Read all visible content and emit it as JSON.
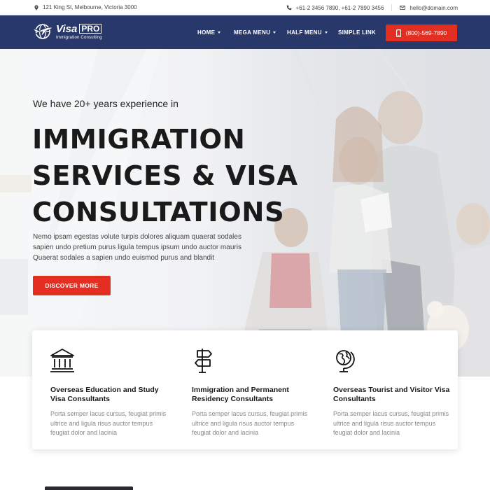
{
  "topbar": {
    "address": "121 King St, Melbourne, Victoria 3000",
    "phones": "+61-2 3456 7890,  +61-2 7890 3456",
    "email": "hello@domain.com",
    "icons": {
      "address": "map-pin-icon",
      "phone": "phone-icon",
      "email": "envelope-icon"
    }
  },
  "header": {
    "logo_name": "Visa",
    "logo_badge": "PRO",
    "logo_tagline": "Immigration Consulting",
    "nav": [
      {
        "label": "HOME",
        "dropdown": true
      },
      {
        "label": "MEGA MENU",
        "dropdown": true
      },
      {
        "label": "HALF MENU",
        "dropdown": true
      },
      {
        "label": "SIMPLE LINK",
        "dropdown": false
      }
    ],
    "call_label": "(800)-569-7890"
  },
  "hero": {
    "pretitle": "We have 20+ years experience in",
    "title_lines": [
      "IMMIGRATION",
      "SERVICES & VISA",
      "CONSULTATIONS"
    ],
    "description": "Nemo ipsam egestas volute turpis dolores aliquam quaerat sodales sapien undo pretium purus ligula tempus ipsum undo auctor mauris Quaerat sodales a sapien undo euismod purus and blandit",
    "cta_label": "DISCOVER MORE"
  },
  "features": [
    {
      "icon": "bank-building-icon",
      "title": "Overseas Education and Study Visa Consultants",
      "text": "Porta semper lacus cursus, feugiat primis ultrice and ligula risus auctor tempus feugiat dolor and lacinia"
    },
    {
      "icon": "signpost-icon",
      "title": "Immigration and Permanent Residency Consultants",
      "text": "Porta semper lacus cursus, feugiat primis ultrice and ligula risus auctor tempus feugiat dolor and lacinia"
    },
    {
      "icon": "globe-stand-icon",
      "title": "Overseas Tourist and Visitor Visa Consultants",
      "text": "Porta semper lacus cursus, feugiat primis ultrice and ligula risus auctor tempus feugiat dolor and lacinia"
    }
  ],
  "colors": {
    "navy": "#28386a",
    "accent": "#e32e22"
  }
}
